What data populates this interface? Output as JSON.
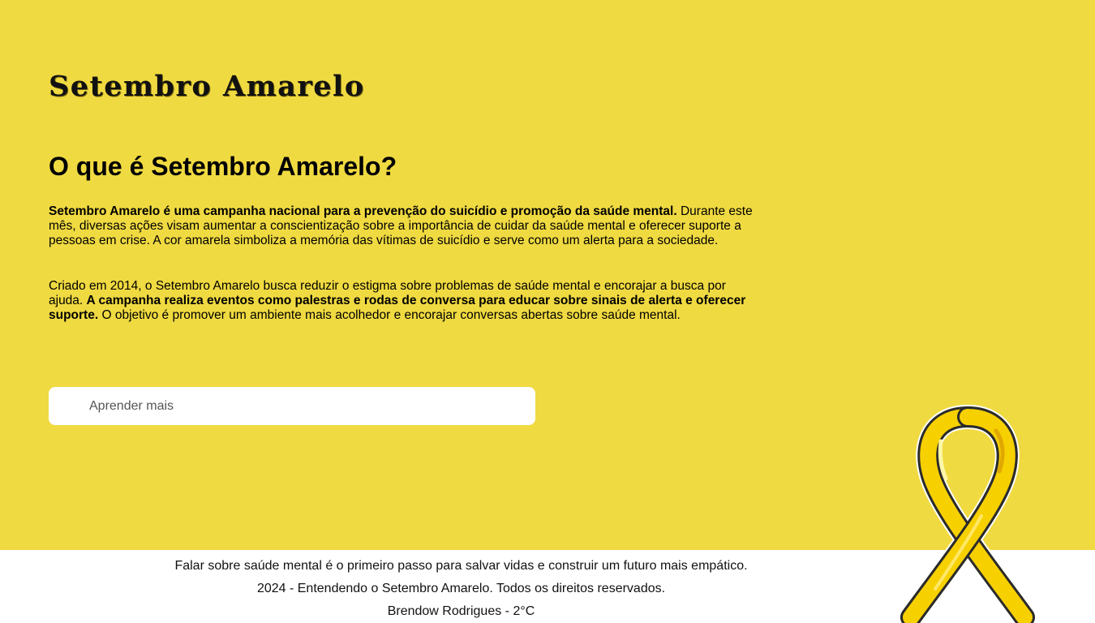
{
  "header": {
    "site_title": "Setembro Amarelo"
  },
  "main": {
    "section_title": "O que é Setembro Amarelo?",
    "paragraph1": {
      "bold": "Setembro Amarelo é uma campanha nacional para a prevenção do suicídio e promoção da saúde mental.",
      "text": " Durante este mês, diversas ações visam aumentar a conscientização sobre a importância de cuidar da saúde mental e oferecer suporte a pessoas em crise. A cor amarela simboliza a memória das vítimas de suicídio e serve como um alerta para a sociedade."
    },
    "paragraph2": {
      "text_start": "Criado em 2014, o Setembro Amarelo busca reduzir o estigma sobre problemas de saúde mental e encorajar a busca por ajuda. ",
      "bold": "A campanha realiza eventos como palestras e rodas de conversa para educar sobre sinais de alerta e oferecer suporte.",
      "text_end": " O objetivo é promover um ambiente mais acolhedor e encorajar conversas abertas sobre saúde mental."
    },
    "learn_more_label": "Aprender mais"
  },
  "footer": {
    "line1": "Falar sobre saúde mental é o primeiro passo para salvar vidas e construir um futuro mais empático.",
    "line2": "2024 - Entendendo o Setembro Amarelo. Todos os direitos reservados.",
    "line3": "Brendow Rodrigues - 2°C"
  },
  "colors": {
    "background": "#f0da41",
    "footer_background": "#ffffff",
    "ribbon_yellow": "#f7d000",
    "ribbon_outline": "#2b2b2b"
  },
  "icons": {
    "ribbon": "yellow-awareness-ribbon-icon"
  }
}
